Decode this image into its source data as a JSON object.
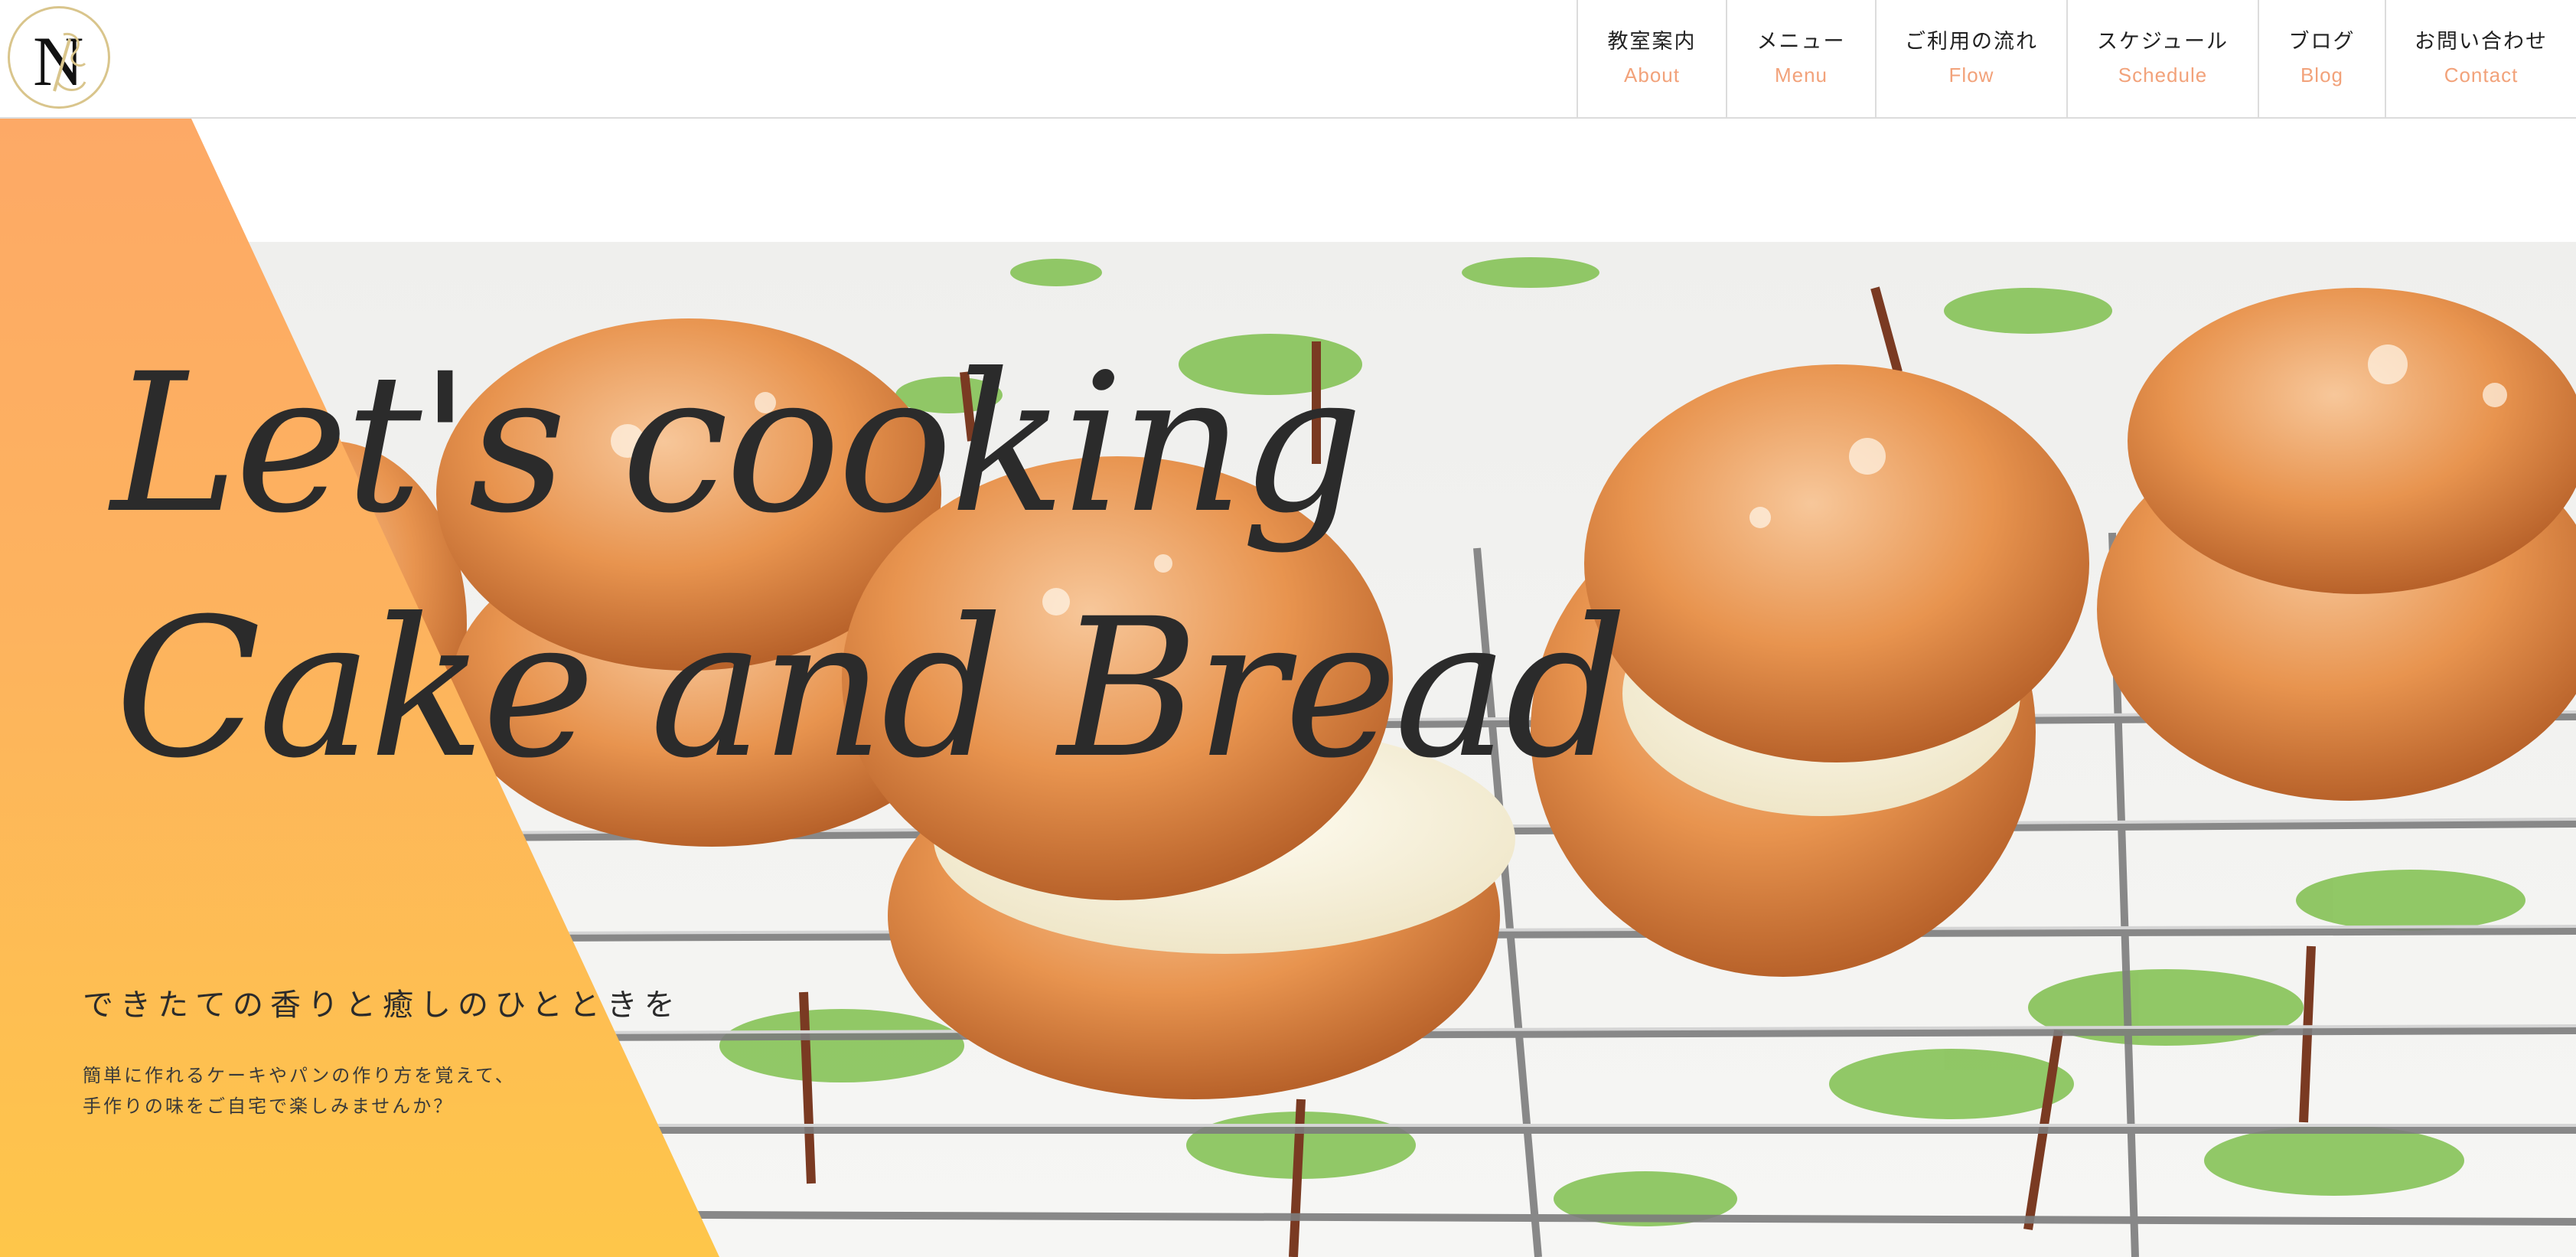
{
  "header": {
    "logo_letter": "N",
    "nav": [
      {
        "ja": "教室案内",
        "en": "About"
      },
      {
        "ja": "メニュー",
        "en": "Menu"
      },
      {
        "ja": "ご利用の流れ",
        "en": "Flow"
      },
      {
        "ja": "スケジュール",
        "en": "Schedule"
      },
      {
        "ja": "ブログ",
        "en": "Blog"
      },
      {
        "ja": "お問い合わせ",
        "en": "Contact"
      }
    ]
  },
  "hero": {
    "script_line_1": "Let's cooking",
    "script_line_2": "Cake and Bread",
    "tagline": "できたての香りと癒しのひとときを",
    "description_line_1": "簡単に作れるケーキやパンの作り方を覚えて、",
    "description_line_2": "手作りの味をご自宅で楽しみませんか？"
  },
  "colors": {
    "accent_en": "#f2a27a",
    "orange_top": "#fda966",
    "orange_bottom": "#fec64a",
    "logo_gold": "#d9c58c",
    "text_dark": "#2b2b2b"
  },
  "icons": {
    "logo": "monogram-n-logo",
    "hero_image": "meringue-cookies-photo"
  }
}
